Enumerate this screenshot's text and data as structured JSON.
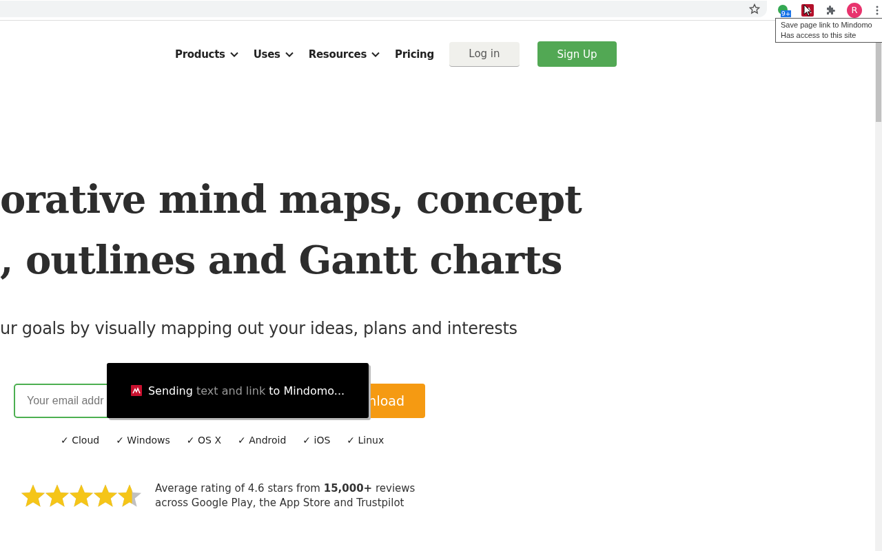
{
  "browser": {
    "extension_badge": "9+",
    "avatar": "R",
    "tooltip": [
      "Save page link to Mindomo",
      "Has access to this site"
    ]
  },
  "nav": {
    "items": [
      {
        "label": "Products",
        "dropdown": true
      },
      {
        "label": "Uses",
        "dropdown": true
      },
      {
        "label": "Resources",
        "dropdown": true
      },
      {
        "label": "Pricing",
        "dropdown": false
      }
    ],
    "login": "Log in",
    "signup": "Sign Up"
  },
  "hero": {
    "headline": [
      "orative mind maps, concept",
      ", outlines and Gantt charts"
    ],
    "subtitle": "ur goals by visually mapping out your ideas, plans and interests"
  },
  "signup_form": {
    "placeholder": "Your email addr",
    "button": "nload"
  },
  "platforms": [
    "✓ Cloud",
    "✓ Windows",
    "✓ OS X",
    "✓ Android",
    "✓ iOS",
    "✓ Linux"
  ],
  "rating": {
    "stars": 4.6,
    "text": "Average rating of 4.6 stars from **15,000+** reviews",
    "text_2": "across Google Play, the App Store and Trustpilot"
  },
  "toast": {
    "parts": [
      {
        "text": "Sending",
        "muted": false
      },
      {
        "text": "text and link",
        "muted": true
      },
      {
        "text": "to Mindomo...",
        "muted": false
      }
    ]
  }
}
